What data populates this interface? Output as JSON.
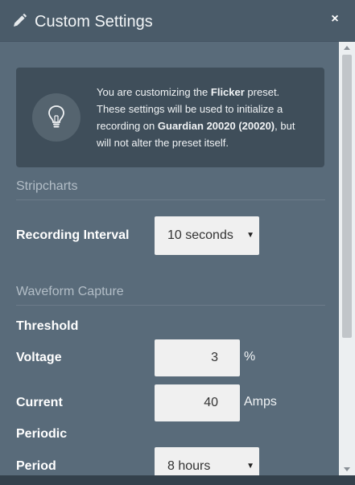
{
  "window": {
    "title": "Custom Settings",
    "close_label": "×"
  },
  "info": {
    "line1_pre": "You are customizing the ",
    "preset_name": "Flicker",
    "line1_post": " preset.",
    "line2": "These settings will be used to initialize a",
    "line3_pre": "recording on ",
    "device_name": "Guardian 20020 (20020)",
    "line3_post": ", but",
    "line4": "will not alter the preset itself."
  },
  "stripcharts": {
    "section_title": "Stripcharts",
    "recording_interval_label": "Recording Interval",
    "recording_interval_value": "10 seconds"
  },
  "waveform": {
    "section_title": "Waveform Capture",
    "threshold_label": "Threshold",
    "voltage_label": "Voltage",
    "voltage_value": "3",
    "voltage_unit": "%",
    "current_label": "Current",
    "current_value": "40",
    "current_unit": "Amps",
    "periodic_label": "Periodic",
    "period_label": "Period",
    "period_value": "8 hours"
  },
  "icons": {
    "title": "pencil-icon",
    "info": "lightbulb-icon",
    "dropdown": "caret-down-icon"
  },
  "colors": {
    "background": "#596b7a",
    "titlebar": "#4a5b69",
    "info_box": "#3f4e5a",
    "section_title": "#b3bec7",
    "input_background": "#f0f0f0"
  }
}
